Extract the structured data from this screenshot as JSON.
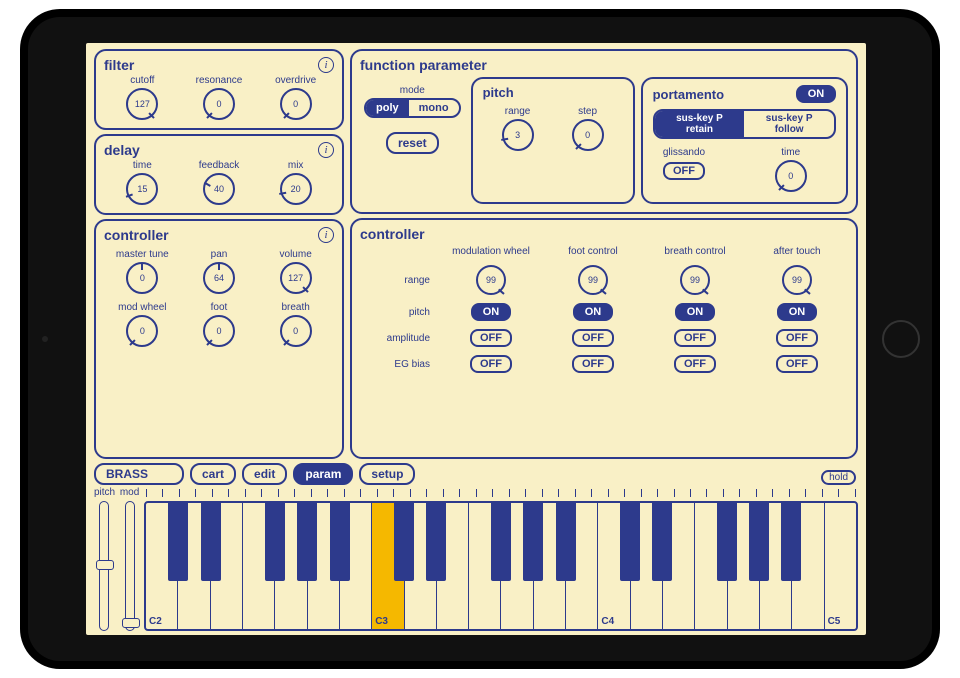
{
  "filter": {
    "title": "filter",
    "knobs": [
      {
        "label": "cutoff",
        "value": "127",
        "angle": 135
      },
      {
        "label": "resonance",
        "value": "0",
        "angle": -135
      },
      {
        "label": "overdrive",
        "value": "0",
        "angle": -135
      }
    ]
  },
  "delay": {
    "title": "delay",
    "knobs": [
      {
        "label": "time",
        "value": "15",
        "angle": -110
      },
      {
        "label": "feedback",
        "value": "40",
        "angle": -60
      },
      {
        "label": "mix",
        "value": "20",
        "angle": -100
      }
    ]
  },
  "controllerLeft": {
    "title": "controller",
    "knobs1": [
      {
        "label": "master tune",
        "value": "0",
        "angle": 0
      },
      {
        "label": "pan",
        "value": "64",
        "angle": 0
      },
      {
        "label": "volume",
        "value": "127",
        "angle": 135
      }
    ],
    "knobs2": [
      {
        "label": "mod wheel",
        "value": "0",
        "angle": -135
      },
      {
        "label": "foot",
        "value": "0",
        "angle": -135
      },
      {
        "label": "breath",
        "value": "0",
        "angle": -135
      }
    ]
  },
  "function": {
    "title": "function parameter",
    "modeLabel": "mode",
    "poly": "poly",
    "mono": "mono",
    "reset": "reset"
  },
  "pitch": {
    "title": "pitch",
    "range": {
      "label": "range",
      "value": "3",
      "angle": -100
    },
    "step": {
      "label": "step",
      "value": "0",
      "angle": -135
    }
  },
  "portamento": {
    "title": "portamento",
    "on": "ON",
    "retain": "sus-key P retain",
    "follow": "sus-key P follow",
    "glissLabel": "glissando",
    "glissVal": "OFF",
    "time": {
      "label": "time",
      "value": "0",
      "angle": -135
    }
  },
  "controllerRight": {
    "title": "controller",
    "cols": [
      "modulation wheel",
      "foot control",
      "breath control",
      "after touch"
    ],
    "rows": {
      "range": {
        "label": "range",
        "vals": [
          "99",
          "99",
          "99",
          "99"
        ],
        "angles": [
          130,
          130,
          130,
          130
        ]
      },
      "pitch": {
        "label": "pitch",
        "vals": [
          "ON",
          "ON",
          "ON",
          "ON"
        ]
      },
      "amplitude": {
        "label": "amplitude",
        "vals": [
          "OFF",
          "OFF",
          "OFF",
          "OFF"
        ]
      },
      "egbias": {
        "label": "EG bias",
        "vals": [
          "OFF",
          "OFF",
          "OFF",
          "OFF"
        ]
      }
    }
  },
  "nav": {
    "patch": "BRASS",
    "cart": "cart",
    "edit": "edit",
    "param": "param",
    "setup": "setup",
    "hold": "hold"
  },
  "wheels": {
    "pitch": "pitch",
    "mod": "mod"
  },
  "keyboard": {
    "labels": {
      "0": "C2",
      "7": "C3",
      "14": "C4",
      "21": "C5"
    },
    "highlight": 7
  }
}
